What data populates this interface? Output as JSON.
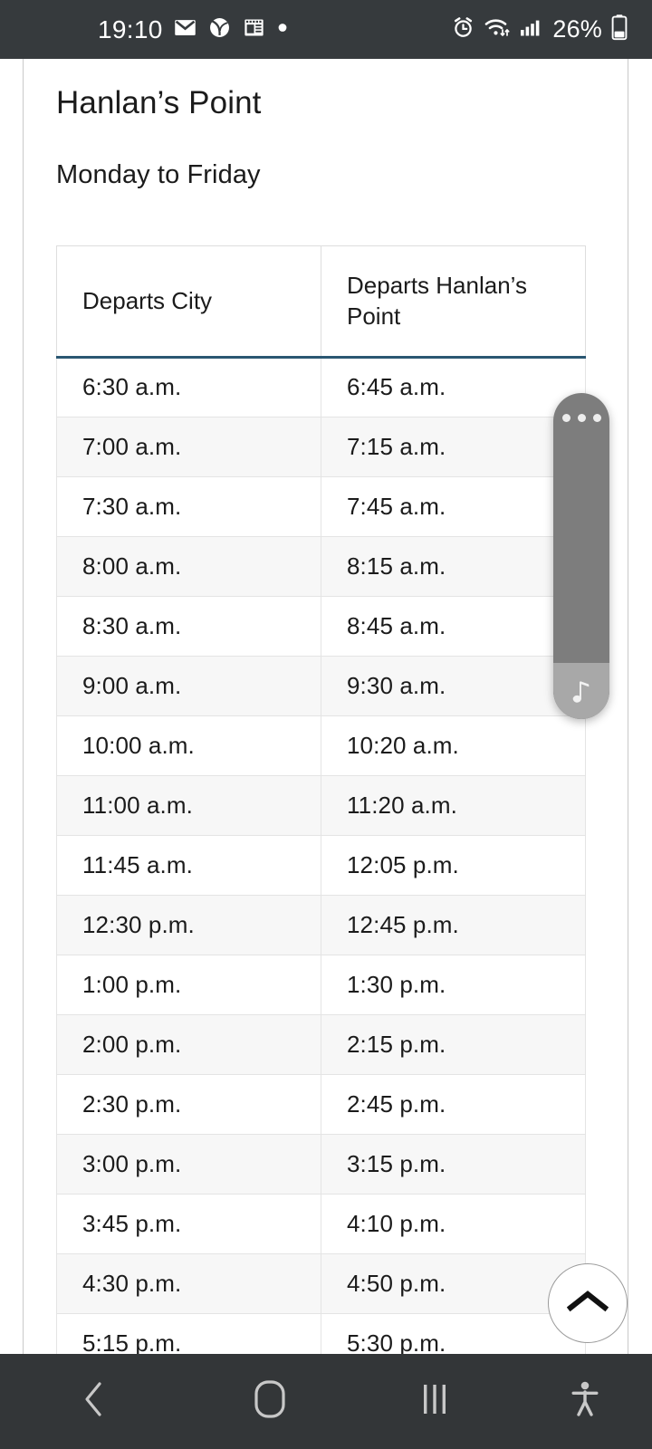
{
  "status_bar": {
    "time": "19:10",
    "battery_percent": "26%",
    "left_icons": [
      "mail-icon",
      "sports-ball-icon",
      "news-icon",
      "dot-icon"
    ],
    "right_icons": [
      "alarm-icon",
      "wifi-icon",
      "cellular-signal-icon",
      "battery-icon"
    ],
    "background_color": "#363a3d"
  },
  "page": {
    "title": "Hanlan’s Point",
    "subtitle": "Monday to Friday"
  },
  "table": {
    "headers": [
      "Departs City",
      "Departs Hanlan’s Point"
    ],
    "header_border_color": "#2a5772",
    "rows": [
      [
        "6:30 a.m.",
        "6:45 a.m."
      ],
      [
        "7:00 a.m.",
        "7:15 a.m."
      ],
      [
        "7:30 a.m.",
        "7:45 a.m."
      ],
      [
        "8:00 a.m.",
        "8:15 a.m."
      ],
      [
        "8:30 a.m.",
        "8:45 a.m."
      ],
      [
        "9:00 a.m.",
        "9:30 a.m."
      ],
      [
        "10:00 a.m.",
        "10:20 a.m."
      ],
      [
        "11:00 a.m.",
        "11:20 a.m."
      ],
      [
        "11:45 a.m.",
        "12:05 p.m."
      ],
      [
        "12:30 p.m.",
        "12:45 p.m."
      ],
      [
        "1:00 p.m.",
        "1:30 p.m."
      ],
      [
        "2:00 p.m.",
        "2:15 p.m."
      ],
      [
        "2:30 p.m.",
        "2:45 p.m."
      ],
      [
        "3:00 p.m.",
        "3:15 p.m."
      ],
      [
        "3:45 p.m.",
        "4:10 p.m."
      ],
      [
        "4:30 p.m.",
        "4:50 p.m."
      ],
      [
        "5:15 p.m.",
        "5:30 p.m."
      ],
      [
        "",
        ""
      ]
    ]
  },
  "edge_panel": {
    "handle_icon": "music-note-icon",
    "menu_icon": "three-dots-icon",
    "color": "#7d7d7d",
    "foot_color": "#a8a8a8"
  },
  "scroll_top_button": {
    "icon": "chevron-up-icon"
  },
  "nav_bar": {
    "buttons": [
      {
        "name": "back-button",
        "icon": "chevron-left-icon"
      },
      {
        "name": "home-button",
        "icon": "home-square-icon"
      },
      {
        "name": "recents-button",
        "icon": "recents-bars-icon"
      },
      {
        "name": "accessibility-button",
        "icon": "accessibility-person-icon"
      }
    ],
    "background_color": "#333638"
  }
}
